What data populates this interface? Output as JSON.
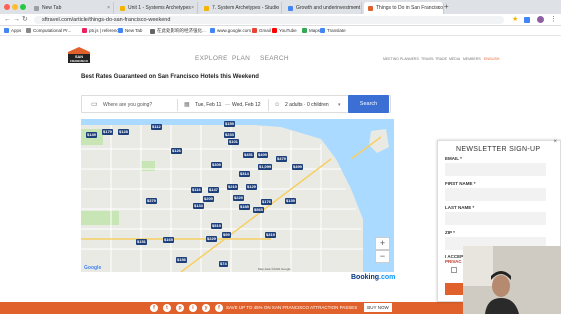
{
  "browser": {
    "tabs": [
      {
        "label": "New Tab",
        "color": "#9aa0a6"
      },
      {
        "label": "Unit 1 - Systems Archetypes",
        "color": "#f4b400"
      },
      {
        "label": "7. System Archetypes - Studio",
        "color": "#f4b400"
      },
      {
        "label": "Growth and underinvestment",
        "color": "#4285f4"
      },
      {
        "label": "Things to Do in San Francisco",
        "color": "#e0612c"
      }
    ],
    "url": "sftravel.com/article/things-do-san-francisco-weekend",
    "bookmarks": [
      {
        "label": "Apps",
        "color": "#4285f4"
      },
      {
        "label": "Computational Pr...",
        "color": "#888"
      },
      {
        "label": "p5.js | reference",
        "color": "#ed225d"
      },
      {
        "label": "New Tab",
        "color": "#4285f4"
      },
      {
        "label": "在此处影响的经济强化...",
        "color": "#666"
      },
      {
        "label": "www.google.com",
        "color": "#4285f4"
      },
      {
        "label": "Gmail",
        "color": "#ea4335"
      },
      {
        "label": "YouTube",
        "color": "#ff0000"
      },
      {
        "label": "Maps",
        "color": "#34a853"
      },
      {
        "label": "Translate",
        "color": "#4285f4"
      }
    ]
  },
  "site": {
    "logo_line1": "SAN",
    "logo_line2": "FRANCISCO",
    "nav": [
      "EXPLORE",
      "PLAN",
      "SEARCH"
    ],
    "right_nav": [
      "MEETING PLANNERS",
      "TRAVEL TRADE",
      "MEDIA",
      "MEMBERS",
      "ENGLISH"
    ],
    "headline": "Best Rates Guaranteed on San Francisco Hotels this Weekend"
  },
  "search": {
    "destination_placeholder": "Where are you going?",
    "checkin": "Tue, Feb 11",
    "arrow": "—",
    "checkout": "Wed, Feb 12",
    "guests": "2 adults · 0 children",
    "button": "Search"
  },
  "map": {
    "pins": [
      {
        "price": "$149"
      },
      {
        "price": "$179"
      },
      {
        "price": "$128"
      },
      {
        "price": "$112"
      },
      {
        "price": "$159"
      },
      {
        "price": "$233"
      },
      {
        "price": "$101"
      },
      {
        "price": "$126"
      },
      {
        "price": "$451"
      },
      {
        "price": "$409"
      },
      {
        "price": "$479"
      },
      {
        "price": "$499"
      },
      {
        "price": "$309"
      },
      {
        "price": "$1,099"
      },
      {
        "price": "$314"
      },
      {
        "price": "$129"
      },
      {
        "price": "$116"
      },
      {
        "price": "$147"
      },
      {
        "price": "$219"
      },
      {
        "price": "$209"
      },
      {
        "price": "$379"
      },
      {
        "price": "$133"
      },
      {
        "price": "$229"
      },
      {
        "price": "$185"
      },
      {
        "price": "$565"
      },
      {
        "price": "$519"
      },
      {
        "price": "$99"
      },
      {
        "price": "$151"
      },
      {
        "price": "$165"
      },
      {
        "price": "$229"
      },
      {
        "price": "$156"
      },
      {
        "price": "$319"
      },
      {
        "price": "$74"
      },
      {
        "price": "$139"
      },
      {
        "price": "$176"
      }
    ],
    "zoom_in": "+",
    "zoom_out": "−",
    "attribution": "Map data ©2020 Google",
    "google": "Google"
  },
  "booking": {
    "part1": "Booking",
    "part2": ".com"
  },
  "newsletter": {
    "title": "NEWSLETTER SIGN-UP",
    "close": "×",
    "email_label": "EMAIL *",
    "first_label": "FIRST NAME *",
    "last_label": "LAST NAME *",
    "zip_label": "ZIP *",
    "accept": "I ACCEPT",
    "privacy": "PRIVAC"
  },
  "promo": {
    "text": "SAVE UP TO 45% ON SAN FRANCISCO ATTRACTION PASSES",
    "button": "BUY NOW",
    "social": [
      "f",
      "t",
      "p",
      "i",
      "y",
      "f"
    ]
  }
}
